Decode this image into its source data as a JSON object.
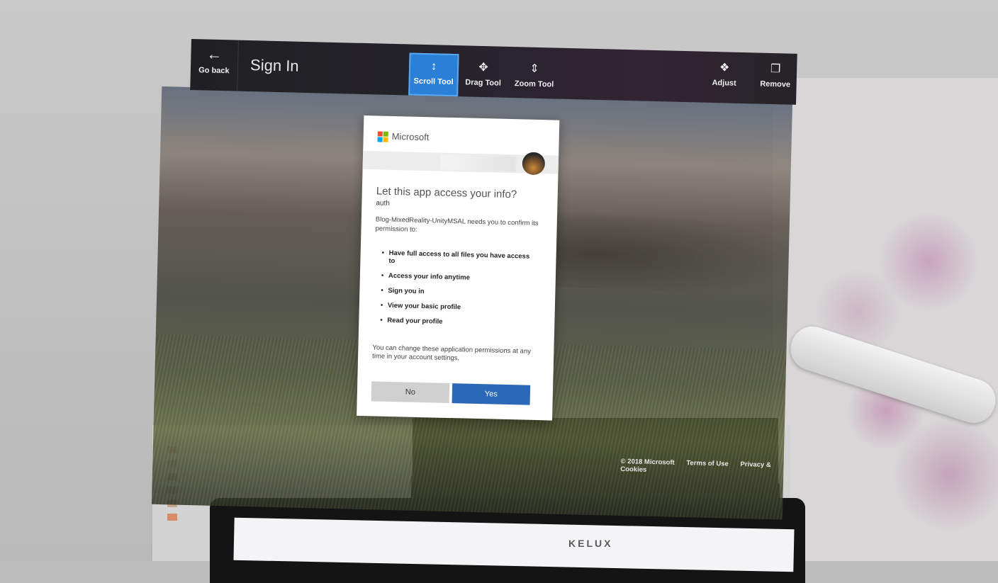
{
  "toolbar": {
    "back_label": "Go back",
    "title": "Sign In",
    "tools": [
      {
        "label": "Scroll Tool",
        "icon": "scroll-icon",
        "active": true
      },
      {
        "label": "Drag Tool",
        "icon": "drag-icon",
        "active": false
      },
      {
        "label": "Zoom Tool",
        "icon": "zoom-icon",
        "active": false
      }
    ],
    "adjust_label": "Adjust",
    "remove_label": "Remove",
    "active_color": "#2a7fd6"
  },
  "dialog": {
    "brand": "Microsoft",
    "heading": "Let this app access your info?",
    "subheading": "auth",
    "description": "Blog-MixedReality-UnityMSAL needs you to confirm its permission to:",
    "permissions": [
      "Have full access to all files you have access to",
      "Access your info anytime",
      "Sign you in",
      "View your basic profile",
      "Read your profile"
    ],
    "note": "You can change these application permissions at any time in your account settings.",
    "no_label": "No",
    "yes_label": "Yes",
    "yes_color": "#2b68b5"
  },
  "footer": {
    "copyright": "© 2018 Microsoft",
    "terms": "Terms of Use",
    "privacy": "Privacy & Cookies"
  },
  "laptop": {
    "brand": "KELUX"
  }
}
